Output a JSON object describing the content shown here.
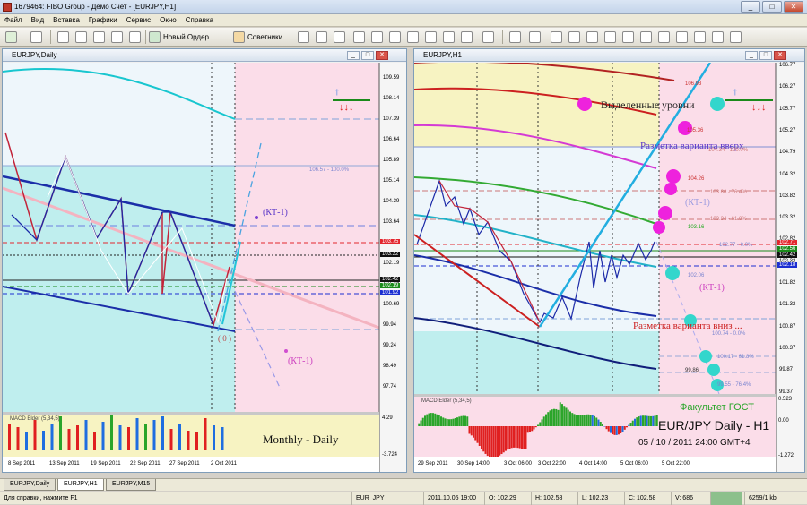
{
  "window": {
    "title": "1679464: FIBO Group - Демо Счет - [EURJPY,H1]"
  },
  "menu": [
    "Файл",
    "Вид",
    "Вставка",
    "Графики",
    "Сервис",
    "Окно",
    "Справка"
  ],
  "toolbar": {
    "new_order": "Новый Ордер",
    "advisors": "Советники"
  },
  "left_chart": {
    "title": "EURJPY,Daily",
    "price_labels": [
      "109.59",
      "108.14",
      "107.39",
      "106.64",
      "105.89",
      "105.14",
      "104.39",
      "103.64",
      "102.94",
      "102.19",
      "101.46",
      "100.69",
      "99.94",
      "99.24",
      "98.49",
      "97.74"
    ],
    "markers": [
      {
        "text": "103.75",
        "color": "#e3262d"
      },
      {
        "text": "103.32",
        "color": "#111111"
      },
      {
        "text": "102.42",
        "color": "#111111"
      },
      {
        "text": "102.19",
        "color": "#1a8a1a"
      },
      {
        "text": "101.92",
        "color": "#1c2fd1"
      }
    ],
    "fib_label": "106.57 - 100.0%",
    "kt_up": "(КТ-1)",
    "kt_down": "(КТ-1)",
    "zero_label": "( 0 )",
    "osc_title": "MACD Elder (5,34,5)",
    "osc_labels": [
      "4.29",
      "-3.724"
    ],
    "caption": "Monthly - Daily",
    "dates": [
      "8 Sep 2011",
      "13 Sep 2011",
      "19 Sep 2011",
      "22 Sep 2011",
      "27 Sep 2011",
      "2 Oct 2011"
    ]
  },
  "right_chart": {
    "title": "EURJPY,H1",
    "price_labels": [
      "106.77",
      "106.27",
      "105.77",
      "105.27",
      "104.79",
      "104.32",
      "103.82",
      "103.32",
      "102.82",
      "102.32",
      "101.82",
      "101.32",
      "100.87",
      "100.37",
      "99.87",
      "99.37"
    ],
    "markers": [
      {
        "text": "102.71",
        "color": "#e3262d"
      },
      {
        "text": "102.56",
        "color": "#1a8a1a"
      },
      {
        "text": "102.42",
        "color": "#111111"
      },
      {
        "text": "102.18",
        "color": "#1c2fd1"
      }
    ],
    "annotations": {
      "levels": "Выделенные уровни",
      "up_markup": "Разметка варианта вверх",
      "down_markup": "Разметка варианта вниз ...",
      "kt_up": "(КТ-1)",
      "kt_down": "(КТ-1)"
    },
    "small_labels": [
      "106.93",
      "105.36",
      "104.34 - 100.0%",
      "104.26",
      "103.86 - 76.4%",
      "103.34 - 61.8%",
      "103.16",
      "102.77 - 0.0%",
      "102.06",
      "100.74 - 0.0%",
      "100.17 - 61.8%",
      "99.86",
      "99.55 - 76.4%"
    ],
    "osc_title": "MACD Elder (5,34,5)",
    "osc_labels": [
      "0.523",
      "0.00",
      "-1.272"
    ],
    "brand": "Факультет ГОСТ",
    "pair": "EUR/JPY Daily - H1",
    "date": "05 / 10 / 2011 24:00 GMT+4",
    "dates": [
      "29 Sep 2011",
      "30 Sep 14:00",
      "3 Oct 06:00",
      "3 Oct 22:00",
      "4 Oct 14:00",
      "5 Oct 06:00",
      "5 Oct 22:00"
    ]
  },
  "tabs": [
    "EURJPY,Daily",
    "EURJPY,H1",
    "EURJPY,M15"
  ],
  "status": {
    "help": "Для справки, нажмите F1",
    "symbol": "EUR_JPY",
    "time": "2011.10.05 19:00",
    "open": "O: 102.29",
    "high": "H: 102.58",
    "low": "L: 102.23",
    "close": "C: 102.58",
    "volume": "V: 686",
    "traffic": "6259/1 kb"
  },
  "colors": {
    "pink_zone": "#fbdde9",
    "cyan_zone": "#bfeeee",
    "yellow_zone": "#f7f3c2",
    "magenta_circle": "#ee22dd",
    "cyan_circle": "#33d6cc"
  }
}
